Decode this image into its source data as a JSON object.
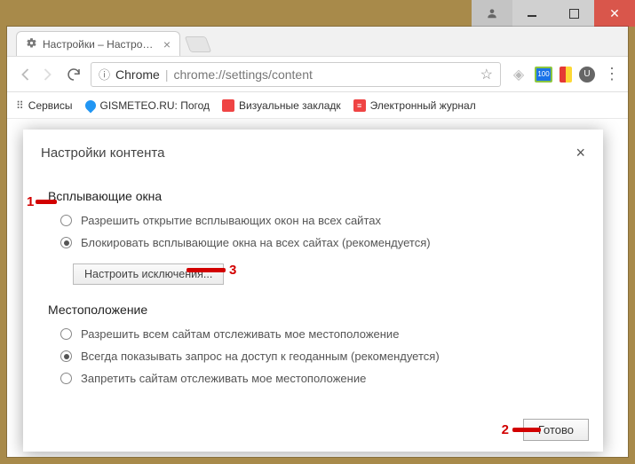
{
  "window": {
    "tab_title": "Настройки – Настройки",
    "address_scheme_label": "Chrome",
    "address_url": "chrome://settings/content"
  },
  "bookmarks": {
    "apps": "Сервисы",
    "items": [
      "GISMETEO.RU: Погод",
      "Визуальные закладк",
      "Электронный журнал"
    ]
  },
  "dialog": {
    "title": "Настройки контента",
    "popups": {
      "heading": "Всплывающие окна",
      "option_allow": "Разрешить открытие всплывающих окон на всех сайтах",
      "option_block": "Блокировать всплывающие окна на всех сайтах (рекомендуется)",
      "exceptions_btn": "Настроить исключения..."
    },
    "location": {
      "heading": "Местоположение",
      "option_allow": "Разрешить всем сайтам отслеживать мое местоположение",
      "option_ask": "Всегда показывать запрос на доступ к геоданным (рекомендуется)",
      "option_block": "Запретить сайтам отслеживать мое местоположение"
    },
    "done_btn": "Готово"
  },
  "annotations": {
    "one": "1",
    "two": "2",
    "three": "3"
  }
}
